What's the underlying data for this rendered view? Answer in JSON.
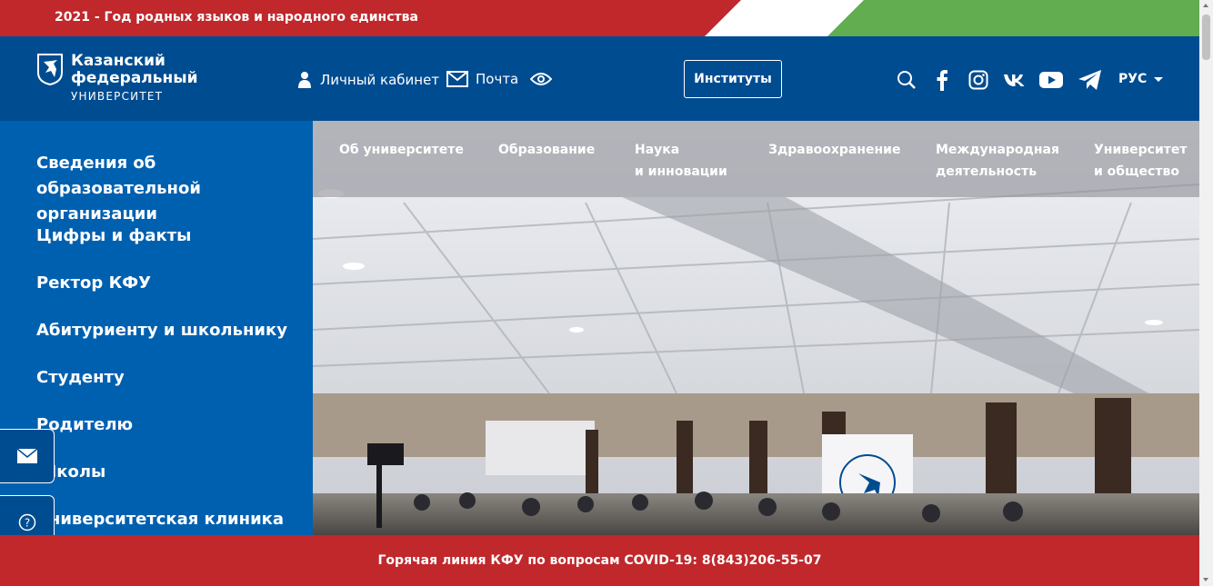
{
  "banner": {
    "text": "2021 - Год родных языков и народного единства"
  },
  "logo": {
    "line1": "Казанский",
    "line2": "федеральный",
    "line3": "УНИВЕРСИТЕТ"
  },
  "header": {
    "personal_account": "Личный кабинет",
    "mail": "Почта",
    "institutes_button": "Институты",
    "language": "РУС",
    "icons": [
      "person-icon",
      "envelope-icon",
      "eye-icon",
      "search-icon",
      "facebook-icon",
      "instagram-icon",
      "vk-icon",
      "youtube-icon",
      "telegram-icon"
    ]
  },
  "sidebar": {
    "items": [
      {
        "label": "Сведения об образовательной организации"
      },
      {
        "label": "Цифры и факты"
      },
      {
        "label": "Ректор КФУ"
      },
      {
        "label": "Абитуриенту и школьнику"
      },
      {
        "label": "Студенту"
      },
      {
        "label": "Родителю"
      },
      {
        "label": "Школы"
      },
      {
        "label": "Университетская клиника"
      }
    ]
  },
  "nav": {
    "items": [
      {
        "line1": "Об университете",
        "line2": ""
      },
      {
        "line1": "Образование",
        "line2": ""
      },
      {
        "line1": "Наука",
        "line2": "и инновации"
      },
      {
        "line1": "Здравоохранение",
        "line2": ""
      },
      {
        "line1": "Международная",
        "line2": "деятельность"
      },
      {
        "line1": "Университет",
        "line2": "и общество"
      }
    ]
  },
  "hotline": {
    "text": "Горячая линия КФУ по вопросам COVID-19: 8(843)206-55-07"
  },
  "colors": {
    "red": "#c0282c",
    "dark_blue": "#004c91",
    "sidebar_blue": "#0060b0",
    "green": "#61ad4f"
  }
}
